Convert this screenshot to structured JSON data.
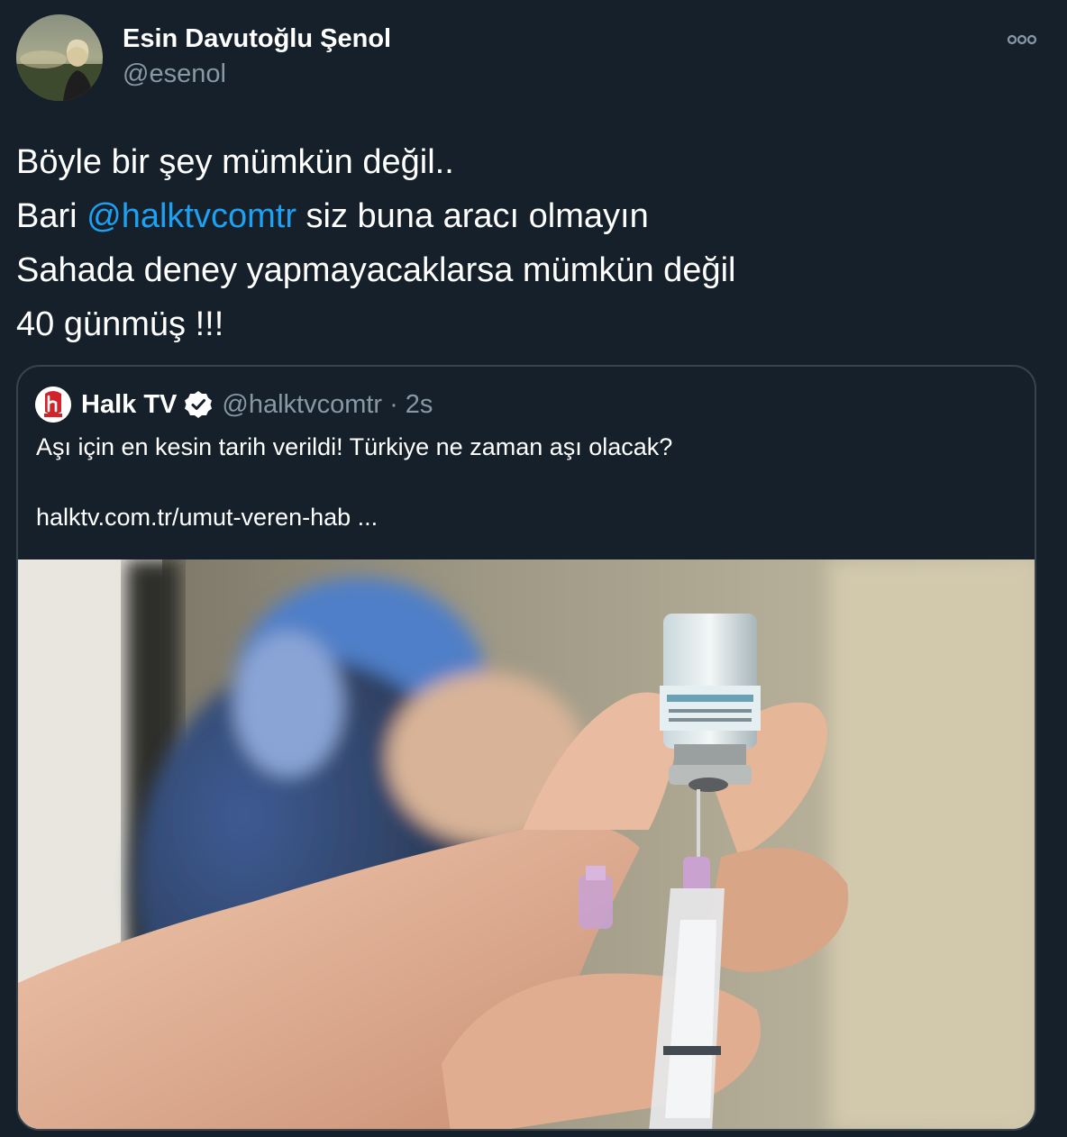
{
  "tweet": {
    "author": {
      "name": "Esin Davutoğlu Şenol",
      "handle": "@esenol"
    },
    "text": {
      "line1": "Böyle bir şey mümkün değil..",
      "line2_prefix": "Bari ",
      "line2_mention": "@halktvcomtr",
      "line2_suffix": " siz buna aracı olmayın",
      "line3": "Sahada deney yapmayacaklarsa mümkün değil",
      "line4": "40 günmüş !!!"
    },
    "more_icon": "more-horizontal-icon"
  },
  "quote": {
    "name": "Halk TV",
    "verified_icon": "verified-badge-icon",
    "handle": "@halktvcomtr",
    "separator": "·",
    "time": "2s",
    "text": "Aşı için en kesin tarih verildi! Türkiye ne zaman aşı olacak?",
    "link": "halktv.com.tr/umut-veren-hab  ...",
    "logo_icon": "halk-tv-logo-icon",
    "image_icon": "vaccine-syringe-photo"
  },
  "colors": {
    "background": "#15202b",
    "text": "#ffffff",
    "secondary": "#8899a6",
    "accent": "#1da1f2",
    "border": "#38444d"
  }
}
